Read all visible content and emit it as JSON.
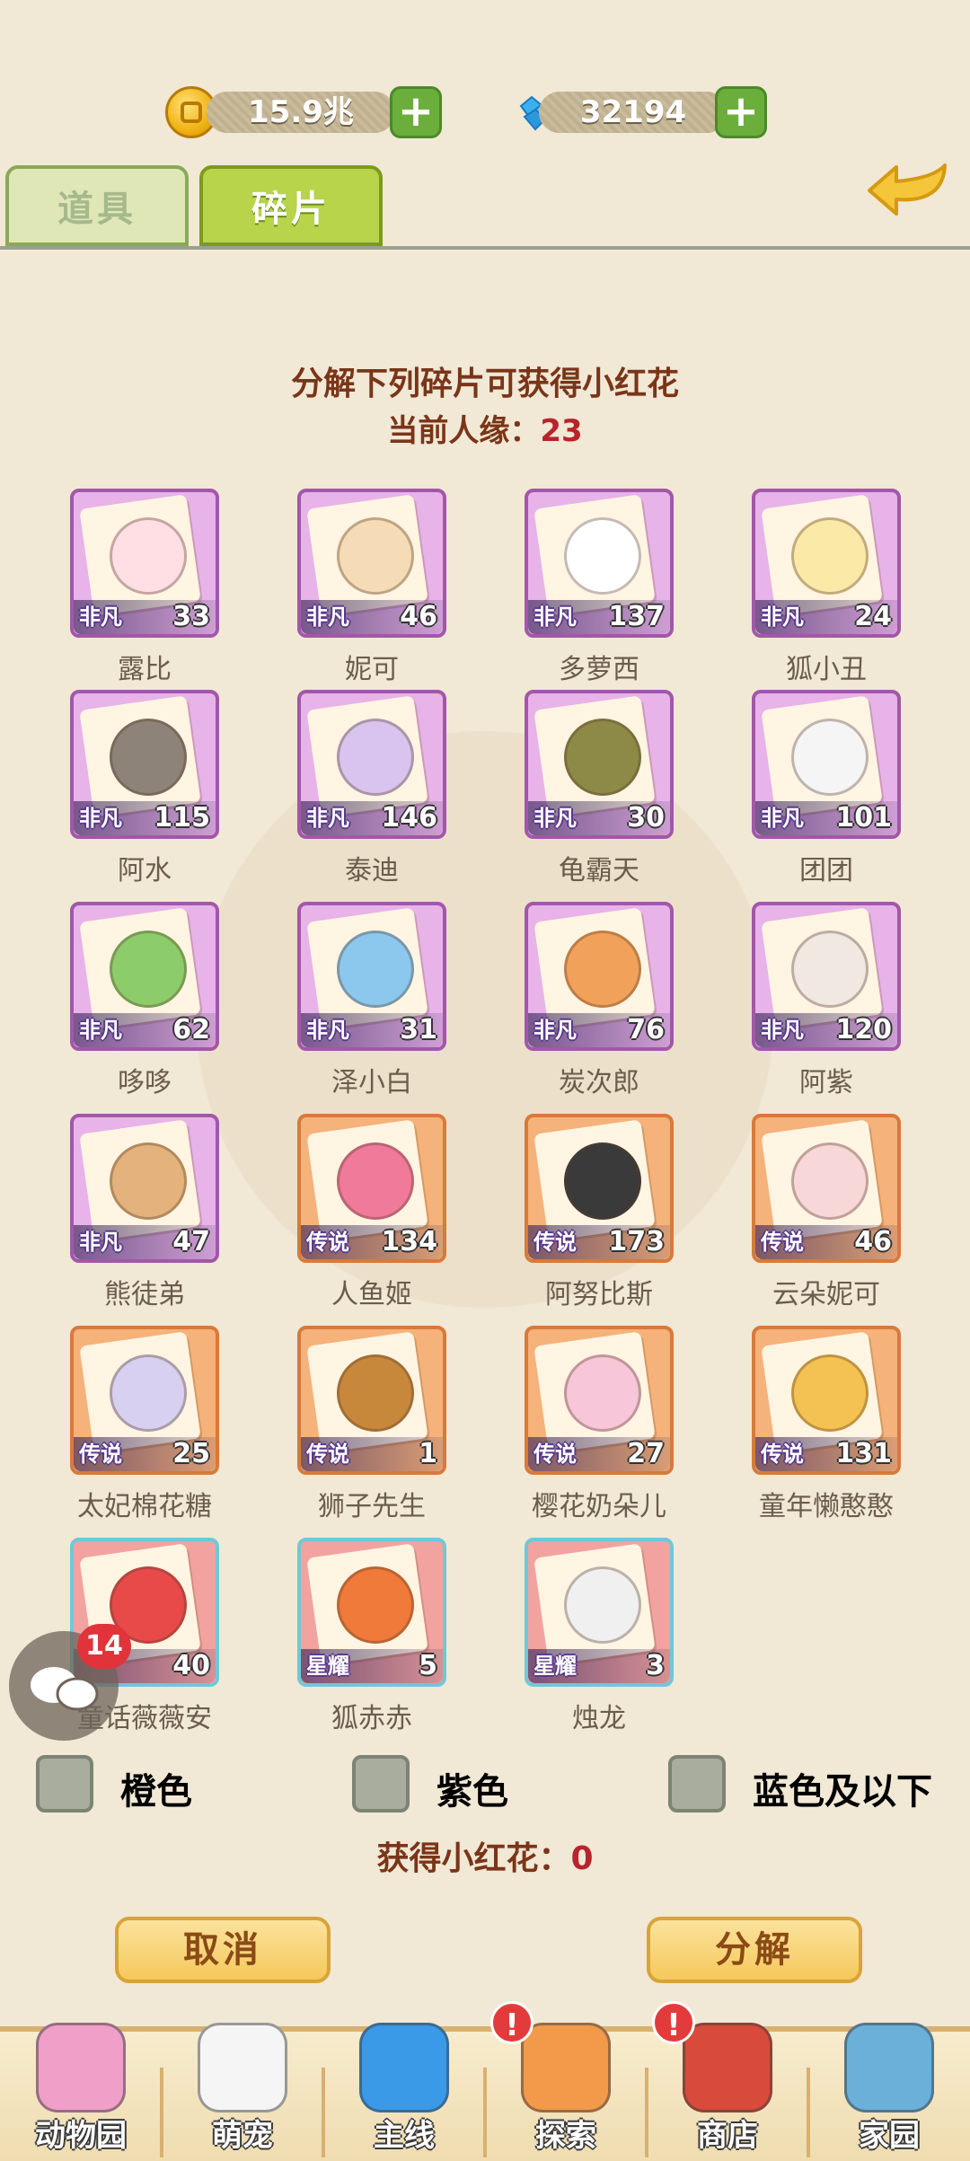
{
  "currency": {
    "coins": "15.9兆",
    "gems": "32194"
  },
  "tabs": [
    {
      "label": "道具"
    },
    {
      "label": "碎片"
    }
  ],
  "header": {
    "title": "分解下列碎片可获得小红花",
    "affinity_label": "当前人缘：",
    "affinity_value": "23"
  },
  "cards": [
    {
      "name": "露比",
      "rarity": "非凡",
      "count": "33",
      "tier": "purple",
      "color": "#ffdfe4"
    },
    {
      "name": "妮可",
      "rarity": "非凡",
      "count": "46",
      "tier": "purple",
      "color": "#f6dcb6"
    },
    {
      "name": "多萝西",
      "rarity": "非凡",
      "count": "137",
      "tier": "purple",
      "color": "#ffffff"
    },
    {
      "name": "狐小丑",
      "rarity": "非凡",
      "count": "24",
      "tier": "purple",
      "color": "#fbe9a8"
    },
    {
      "name": "阿水",
      "rarity": "非凡",
      "count": "115",
      "tier": "purple",
      "color": "#8d8379"
    },
    {
      "name": "泰迪",
      "rarity": "非凡",
      "count": "146",
      "tier": "purple",
      "color": "#d8c4ee"
    },
    {
      "name": "龟霸天",
      "rarity": "非凡",
      "count": "30",
      "tier": "purple",
      "color": "#8d8a48"
    },
    {
      "name": "团团",
      "rarity": "非凡",
      "count": "101",
      "tier": "purple",
      "color": "#f5f5f5"
    },
    {
      "name": "哆哆",
      "rarity": "非凡",
      "count": "62",
      "tier": "purple",
      "color": "#8ccc6a"
    },
    {
      "name": "泽小白",
      "rarity": "非凡",
      "count": "31",
      "tier": "purple",
      "color": "#8cc8ee"
    },
    {
      "name": "炭次郎",
      "rarity": "非凡",
      "count": "76",
      "tier": "purple",
      "color": "#f2a15a"
    },
    {
      "name": "阿紫",
      "rarity": "非凡",
      "count": "120",
      "tier": "purple",
      "color": "#f2e8e2"
    },
    {
      "name": "熊徒弟",
      "rarity": "非凡",
      "count": "47",
      "tier": "purple",
      "color": "#e4b27c"
    },
    {
      "name": "人鱼姬",
      "rarity": "传说",
      "count": "134",
      "tier": "orange",
      "color": "#f07a9a"
    },
    {
      "name": "阿努比斯",
      "rarity": "传说",
      "count": "173",
      "tier": "orange",
      "color": "#3a3a3a"
    },
    {
      "name": "云朵妮可",
      "rarity": "传说",
      "count": "46",
      "tier": "orange",
      "color": "#f7d7d7"
    },
    {
      "name": "太妃棉花糖",
      "rarity": "传说",
      "count": "25",
      "tier": "orange",
      "color": "#d8d0f0"
    },
    {
      "name": "狮子先生",
      "rarity": "传说",
      "count": "1",
      "tier": "orange",
      "color": "#c8883c"
    },
    {
      "name": "樱花奶朵儿",
      "rarity": "传说",
      "count": "27",
      "tier": "orange",
      "color": "#f7c6d8"
    },
    {
      "name": "童年懒憨憨",
      "rarity": "传说",
      "count": "131",
      "tier": "orange",
      "color": "#f4c252"
    },
    {
      "name": "童话薇薇安",
      "rarity": "",
      "count": "40",
      "tier": "star",
      "color": "#e84a4a"
    },
    {
      "name": "狐赤赤",
      "rarity": "星耀",
      "count": "5",
      "tier": "star",
      "color": "#ef7a3a"
    },
    {
      "name": "烛龙",
      "rarity": "星耀",
      "count": "3",
      "tier": "star",
      "color": "#f0f0f0"
    }
  ],
  "filters": [
    {
      "label": "橙色",
      "color": "#f47a2a"
    },
    {
      "label": "紫色",
      "color": "#d63ad6"
    },
    {
      "label": "蓝色及以下",
      "color": "#2a9ad6"
    }
  ],
  "reward": {
    "label": "获得小红花：",
    "value": "0"
  },
  "buttons": {
    "cancel": "取消",
    "decompose": "分解"
  },
  "chat": {
    "badge": "14"
  },
  "nav": [
    {
      "label": "动物园",
      "icon": "carousel-icon",
      "alert": false,
      "color": "#f0a0c8"
    },
    {
      "label": "萌宠",
      "icon": "pets-icon",
      "alert": false,
      "color": "#f5f5f5"
    },
    {
      "label": "主线",
      "icon": "mission-icon",
      "alert": false,
      "color": "#3a9ae8"
    },
    {
      "label": "探索",
      "icon": "explore-icon",
      "alert": true,
      "color": "#f29a4a"
    },
    {
      "label": "商店",
      "icon": "shop-icon",
      "alert": true,
      "color": "#d84a3a"
    },
    {
      "label": "家园",
      "icon": "home-icon",
      "alert": false,
      "color": "#6ab0d8"
    }
  ],
  "alert_glyph": "!"
}
